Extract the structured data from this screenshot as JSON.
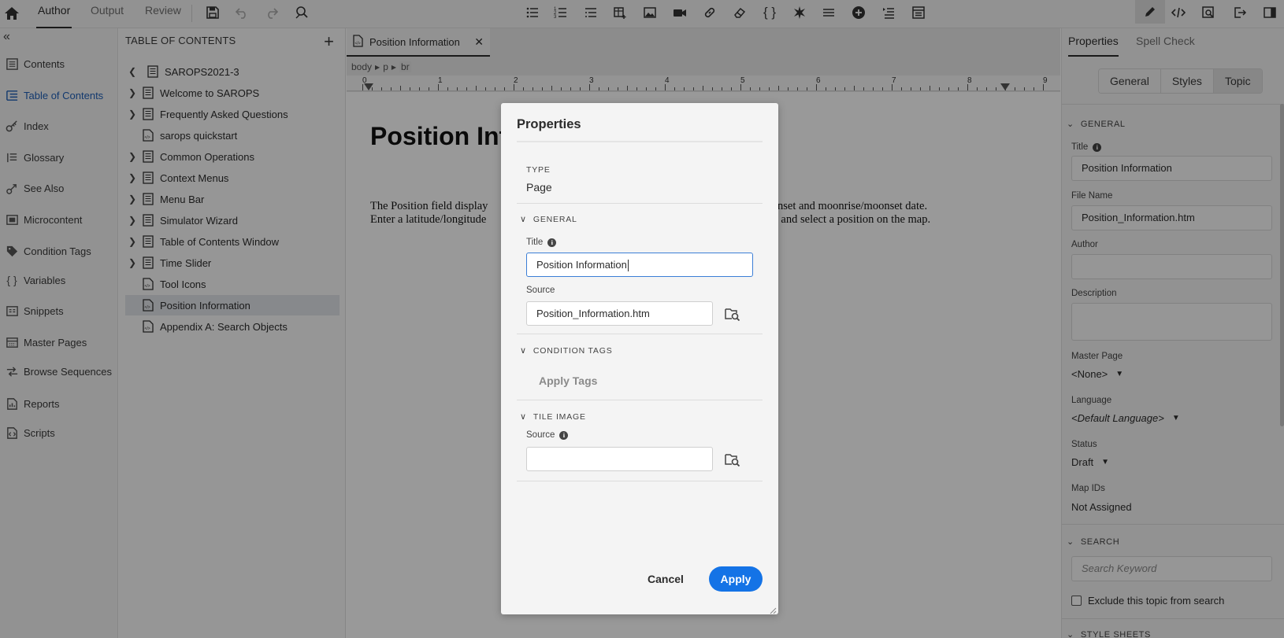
{
  "topbar": {
    "tabs": [
      {
        "label": "Author",
        "active": true
      },
      {
        "label": "Output",
        "active": false
      },
      {
        "label": "Review",
        "active": false
      }
    ],
    "toolbar_icons": [
      "save-icon",
      "undo-icon",
      "redo-icon",
      "find-replace-icon",
      "bullet-list-icon",
      "numbered-list-icon",
      "multilevel-list-icon",
      "insert-table-icon",
      "insert-image-icon",
      "insert-video-icon",
      "insert-link-icon",
      "eraser-icon",
      "variable-braces-icon",
      "special-character-icon",
      "horizontal-rule-icon",
      "add-circle-icon",
      "insert-snippet-icon",
      "insert-toc-icon"
    ],
    "right_icons": [
      "edit-pencil-icon",
      "code-view-icon",
      "preview-icon",
      "export-icon",
      "panel-toggle-icon"
    ]
  },
  "leftnav": {
    "items": [
      {
        "label": "Contents",
        "icon": "contents-icon",
        "active": false
      },
      {
        "label": "Table of Contents",
        "icon": "toc-icon",
        "active": true
      },
      {
        "label": "Index",
        "icon": "key-icon",
        "active": false
      },
      {
        "label": "Glossary",
        "icon": "glossary-icon",
        "active": false
      },
      {
        "label": "See Also",
        "icon": "see-also-icon",
        "active": false
      },
      {
        "label": "Microcontent",
        "icon": "microcontent-icon",
        "active": false
      },
      {
        "label": "Condition Tags",
        "icon": "tag-icon",
        "active": false
      },
      {
        "label": "Variables",
        "icon": "braces-icon",
        "active": false
      },
      {
        "label": "Snippets",
        "icon": "snippets-icon",
        "active": false
      },
      {
        "label": "Master Pages",
        "icon": "master-pages-icon",
        "active": false
      },
      {
        "label": "Browse Sequences",
        "icon": "browse-sequences-icon",
        "active": false
      },
      {
        "label": "Reports",
        "icon": "reports-icon",
        "active": false
      },
      {
        "label": "Scripts",
        "icon": "scripts-icon",
        "active": false
      }
    ]
  },
  "toc": {
    "heading": "TABLE OF CONTENTS",
    "root": "SAROPS2021-3",
    "items": [
      {
        "label": "Welcome to SAROPS",
        "expandable": true,
        "type": "book"
      },
      {
        "label": "Frequently Asked Questions",
        "expandable": true,
        "type": "book"
      },
      {
        "label": "sarops quickstart",
        "expandable": false,
        "type": "page"
      },
      {
        "label": "Common Operations",
        "expandable": true,
        "type": "book"
      },
      {
        "label": "Context Menus",
        "expandable": true,
        "type": "book"
      },
      {
        "label": "Menu Bar",
        "expandable": true,
        "type": "book"
      },
      {
        "label": "Simulator Wizard",
        "expandable": true,
        "type": "book"
      },
      {
        "label": "Table of Contents Window",
        "expandable": true,
        "type": "book"
      },
      {
        "label": "Time Slider",
        "expandable": true,
        "type": "book"
      },
      {
        "label": "Tool Icons",
        "expandable": false,
        "type": "page"
      },
      {
        "label": "Position Information",
        "expandable": false,
        "type": "page",
        "selected": true
      },
      {
        "label": "Appendix A: Search Objects",
        "expandable": false,
        "type": "page"
      }
    ]
  },
  "editor": {
    "tab_label": "Position Information",
    "breadcrumb": [
      "body",
      "p",
      "br"
    ],
    "ruler_numbers": [
      "0",
      "1",
      "2",
      "3",
      "4",
      "5",
      "6",
      "7",
      "8",
      "9"
    ],
    "heading": "Position Inf",
    "para_line1_left": "The Position field display",
    "para_line2_left": "Enter a latitude/longitude",
    "para_line1_right": "se/sunset and moonrise/moonset date.",
    "para_line2_right": "utton and select a position on the map."
  },
  "rightpanel": {
    "tabs": [
      {
        "label": "Properties",
        "active": true
      },
      {
        "label": "Spell Check",
        "active": false
      }
    ],
    "segments": [
      "General",
      "Styles",
      "Topic"
    ],
    "general_heading": "GENERAL",
    "title_label": "Title",
    "title_value": "Position Information",
    "filename_label": "File Name",
    "filename_value": "Position_Information.htm",
    "author_label": "Author",
    "author_value": "",
    "description_label": "Description",
    "description_value": "",
    "masterpage_label": "Master Page",
    "masterpage_value": "<None>",
    "language_label": "Language",
    "language_value": "<Default Language>",
    "status_label": "Status",
    "status_value": "Draft",
    "mapids_label": "Map IDs",
    "mapids_value": "Not Assigned",
    "search_heading": "SEARCH",
    "search_placeholder": "Search Keyword",
    "exclude_label": "Exclude this topic from search",
    "stylesheets_heading": "STYLE SHEETS"
  },
  "modal": {
    "title": "Properties",
    "type_label": "TYPE",
    "type_value": "Page",
    "general_heading": "GENERAL",
    "title_label": "Title",
    "title_value": "Position Information",
    "source_label": "Source",
    "source_value": "Position_Information.htm",
    "condition_tags_heading": "CONDITION TAGS",
    "apply_tags_label": "Apply Tags",
    "tile_image_heading": "TILE IMAGE",
    "tile_source_label": "Source",
    "tile_source_value": "",
    "cancel_label": "Cancel",
    "apply_label": "Apply",
    "colors": {
      "accent": "#1473e6",
      "focus_border": "#3b7ed6"
    }
  }
}
